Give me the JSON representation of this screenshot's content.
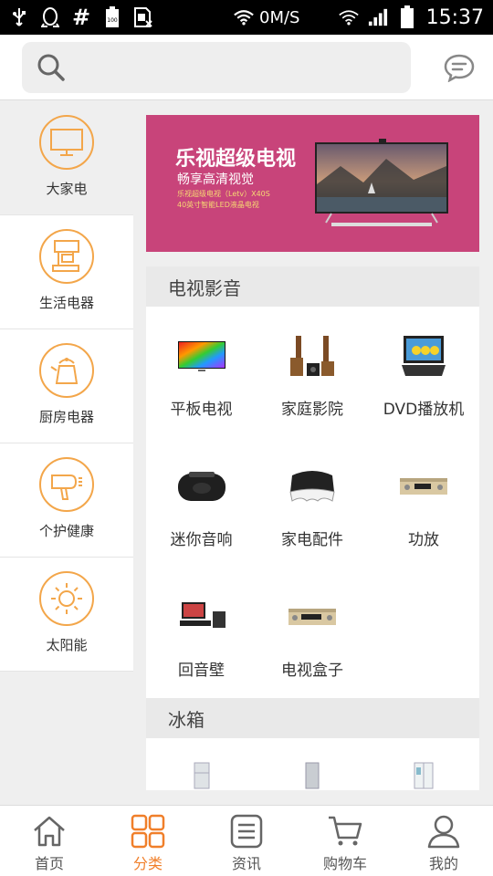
{
  "status_bar": {
    "net_speed": "0M/S",
    "time": "15:37",
    "grid_sym": "#",
    "battery_text": "100"
  },
  "header": {
    "search_placeholder": ""
  },
  "sidebar": {
    "items": [
      {
        "label": "大家电"
      },
      {
        "label": "生活电器"
      },
      {
        "label": "厨房电器"
      },
      {
        "label": "个护健康"
      },
      {
        "label": "太阳能"
      }
    ]
  },
  "banner": {
    "title": "乐视超级电视",
    "subtitle": "畅享高清视觉",
    "line1": "乐视超级电视（Letv）X40S",
    "line2": "40英寸智能LED液晶电视"
  },
  "sections": [
    {
      "title": "电视影音",
      "items": [
        {
          "label": "平板电视"
        },
        {
          "label": "家庭影院"
        },
        {
          "label": "DVD播放机"
        },
        {
          "label": "迷你音响"
        },
        {
          "label": "家电配件"
        },
        {
          "label": "功放"
        },
        {
          "label": "回音壁"
        },
        {
          "label": "电视盒子"
        }
      ]
    },
    {
      "title": "冰箱"
    }
  ],
  "tabbar": {
    "tabs": [
      {
        "label": "首页"
      },
      {
        "label": "分类"
      },
      {
        "label": "资讯"
      },
      {
        "label": "购物车"
      },
      {
        "label": "我的"
      }
    ],
    "active_color": "#f07f2a",
    "inactive_color": "#555555"
  },
  "colors": {
    "accent": "#f3a64a",
    "banner_bg": "#c8447a"
  }
}
